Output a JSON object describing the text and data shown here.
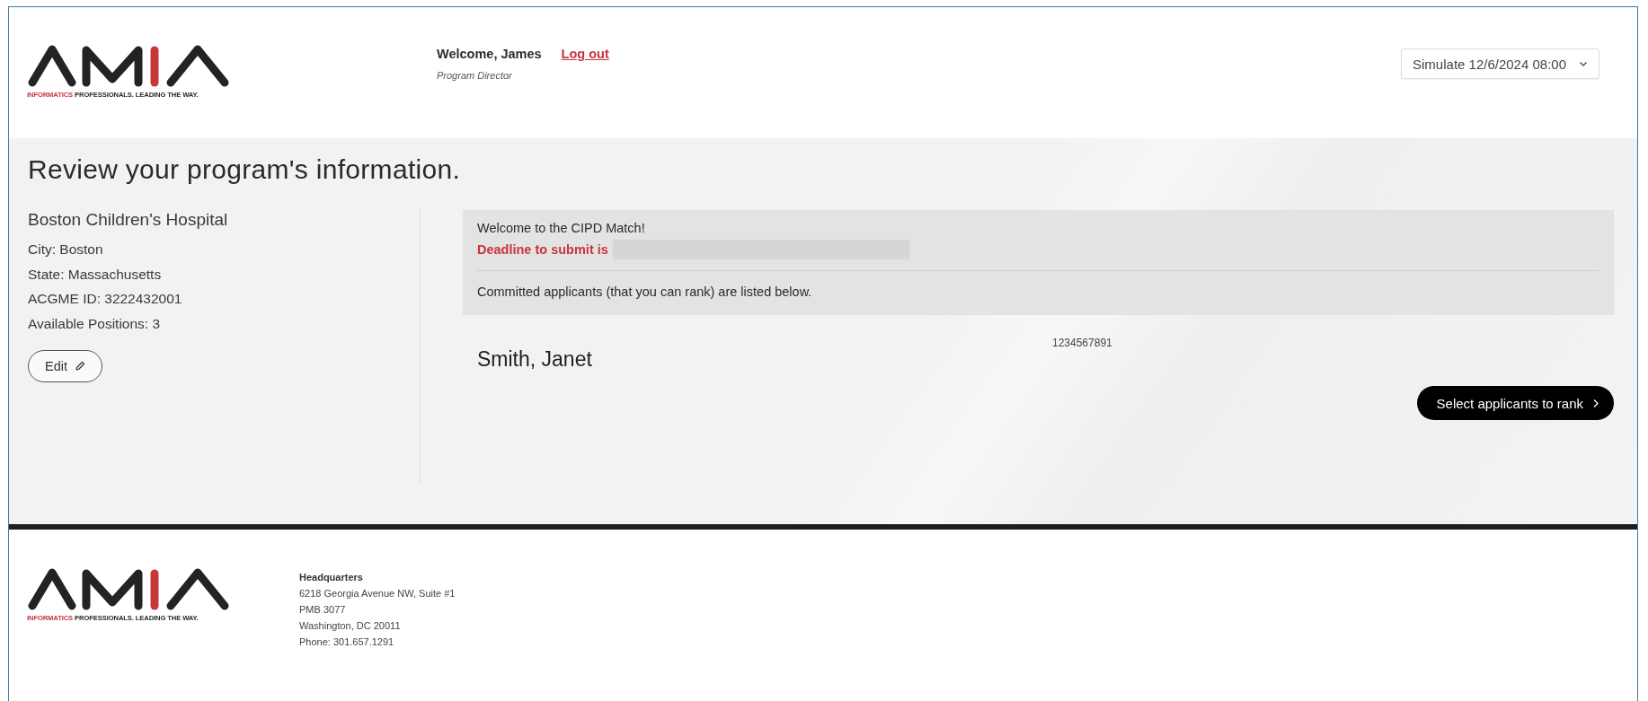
{
  "header": {
    "logo_tagline": {
      "highlight": "INFORMATICS",
      "rest": " PROFESSIONALS. LEADING THE WAY."
    },
    "welcome": "Welcome, James",
    "logout": "Log out",
    "role": "Program Director",
    "simulate": "Simulate 12/6/2024 08:00"
  },
  "page_title": "Review your program's information.",
  "program": {
    "name": "Boston Children's Hospital",
    "details": [
      "City: Boston",
      "State: Massachusetts",
      "ACGME ID: 3222432001",
      "Available Positions: 3"
    ],
    "edit_button": "Edit"
  },
  "notice": {
    "greeting": "Welcome to the CIPD Match!",
    "deadline": "Deadline to submit is",
    "info": "Committed applicants (that you can rank) are listed below."
  },
  "applicants": [
    {
      "name": "Smith, Janet",
      "id": "1234567891"
    }
  ],
  "select_button": "Select applicants to rank",
  "footer": {
    "logo_tagline": {
      "highlight": "INFORMATICS",
      "rest": " PROFESSIONALS. LEADING THE WAY."
    },
    "heading": "Headquarters",
    "address": [
      "6218 Georgia Avenue NW, Suite #1",
      "PMB 3077",
      "Washington, DC 20011",
      "Phone: 301.657.1291"
    ]
  }
}
